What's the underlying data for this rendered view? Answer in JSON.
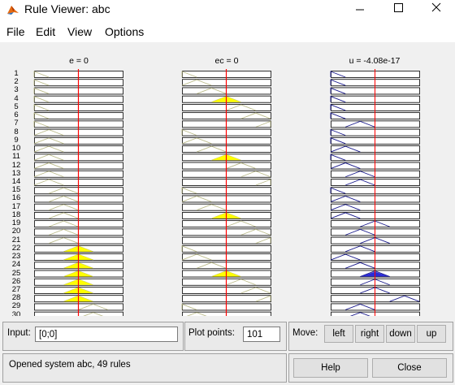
{
  "window": {
    "title": "Rule Viewer: abc",
    "app_icon": "matlab-icon"
  },
  "menu": [
    "File",
    "Edit",
    "View",
    "Options"
  ],
  "columns": [
    {
      "label": "e = 0"
    },
    {
      "label": "ec = 0"
    },
    {
      "label": "u = -4.08e-17"
    }
  ],
  "rows": [
    "1",
    "2",
    "3",
    "4",
    "5",
    "6",
    "7",
    "8",
    "9",
    "10",
    "11",
    "12",
    "13",
    "14",
    "15",
    "16",
    "17",
    "18",
    "19",
    "20",
    "21",
    "22",
    "23",
    "24",
    "25",
    "26",
    "27",
    "28",
    "29",
    "30"
  ],
  "inputs": {
    "input_label": "Input:",
    "input_value": "[0;0]",
    "plot_points_label": "Plot points:",
    "plot_points_value": "101",
    "move_label": "Move:",
    "move_buttons": [
      "left",
      "right",
      "down",
      "up"
    ]
  },
  "status": "Opened system abc, 49 rules",
  "buttons": {
    "help": "Help",
    "close": "Close"
  },
  "colors": {
    "input_mf_line": "#bcbc8c",
    "output_mf_line": "#1a1a8c",
    "fired_fill": "#ffff00",
    "output_fired_fill": "#2b2bd8",
    "cursor_line": "#ff0000"
  }
}
